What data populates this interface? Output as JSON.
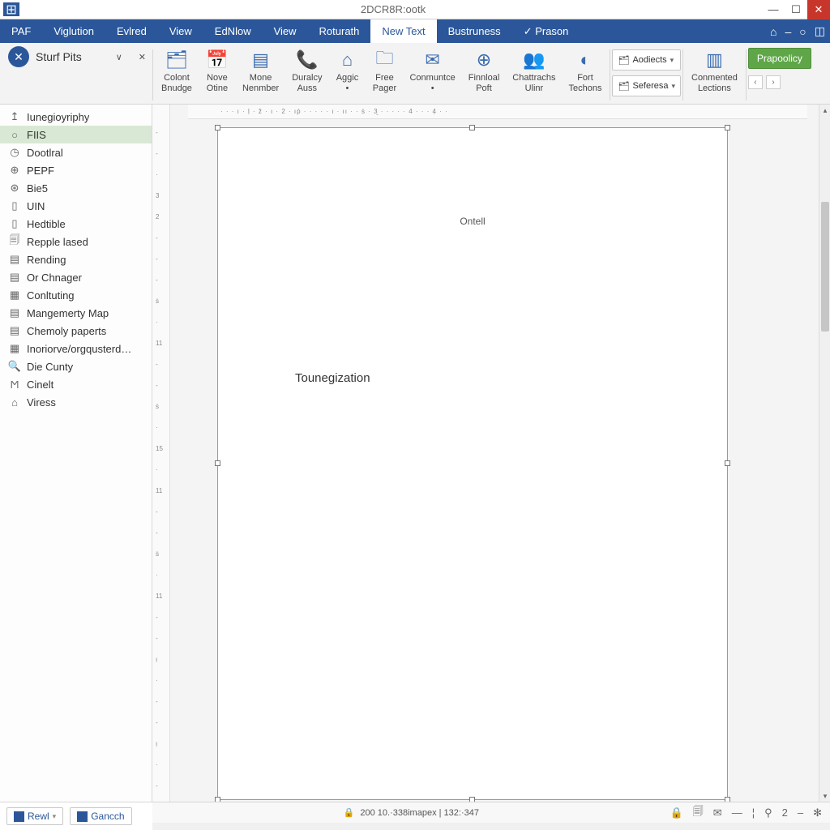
{
  "title": "2DCR8R:ootk",
  "menu": [
    "PAF",
    "Viglution",
    "Evlred",
    "View",
    "EdNlow",
    "View",
    "Roturath",
    "New Text",
    "Bustruness",
    "✓ Prason"
  ],
  "menu_active_index": 7,
  "side_panel_title": "Sturf Pits",
  "ribbon_groups": [
    {
      "icon": "colont",
      "label": "Colont\nBnudge"
    },
    {
      "icon": "nove",
      "label": "Nove\nOtine"
    },
    {
      "icon": "mone",
      "label": "Mone\nNenmber"
    },
    {
      "icon": "phone",
      "label": "Duralcy\nAuss"
    },
    {
      "icon": "home",
      "label": "Aggic\n•"
    },
    {
      "icon": "free",
      "label": "Free\nPager"
    },
    {
      "icon": "comm",
      "label": "Conmuntce\n•"
    },
    {
      "icon": "fin",
      "label": "Finnloal\nPoft"
    },
    {
      "icon": "chat",
      "label": "Chattrachs\nUlinr"
    },
    {
      "icon": "fort",
      "label": "Fort\nTechons"
    }
  ],
  "ribbon_drop1": "Aodiects",
  "ribbon_drop2": "Seferesa",
  "ribbon_right_group": {
    "label": "Conmented\nLections"
  },
  "ribbon_green": "Prapoolicy",
  "sidebar_items": [
    {
      "icon": "↥",
      "label": "Iunegioyriphy"
    },
    {
      "icon": "○",
      "label": "FIIS",
      "sel": true
    },
    {
      "icon": "◷",
      "label": "Dootlral"
    },
    {
      "icon": "⊕",
      "label": "PEPF"
    },
    {
      "icon": "⊛",
      "label": "Bie5"
    },
    {
      "icon": "▯",
      "label": "UIN"
    },
    {
      "icon": "▯",
      "label": "Hedtible"
    },
    {
      "icon": "🗐",
      "label": "Repple lased"
    },
    {
      "icon": "▤",
      "label": "Rending"
    },
    {
      "icon": "▤",
      "label": "Or Chnager"
    },
    {
      "icon": "▦",
      "label": "Conltuting"
    },
    {
      "icon": "▤",
      "label": "Mangemerty Map"
    },
    {
      "icon": "▤",
      "label": "Chemoly paperts"
    },
    {
      "icon": "▦",
      "label": "Inoriorve/orgqusterd…"
    },
    {
      "icon": "🔍",
      "label": "Die Cunty"
    },
    {
      "icon": "Ϻ",
      "label": "Cinelt"
    },
    {
      "icon": "⌂",
      "label": "Viress"
    }
  ],
  "page_text1": "Ontell",
  "page_text2": "Tounegization",
  "footer_btn1": "Rewl",
  "footer_btn2": "Gancch",
  "status_center": "200 10.·338imapex  |  132:·347",
  "status_num": "2",
  "hruler_text": "· · ·  ı ·  ḷ ·  ẑ ·  ı ·  2 ·  ıṗ ·  · ·  · ·  ı ·  ıı ·  ·  ṡ ·  3̱ ·  · ·  · ·  4 ·  · ·  4̣ ·  ·",
  "vruler_ticks": [
    "-",
    "-",
    "·",
    "3",
    "2",
    "-",
    "-",
    "-",
    "ṡ",
    "·",
    "11",
    "-",
    "-",
    "ṡ",
    "·",
    "15",
    "·",
    "11",
    "-",
    "-",
    "ṡ",
    "·",
    "11",
    "-",
    "-",
    "ı̣",
    "·",
    "-",
    "-",
    "ı̣",
    "·",
    "-"
  ]
}
